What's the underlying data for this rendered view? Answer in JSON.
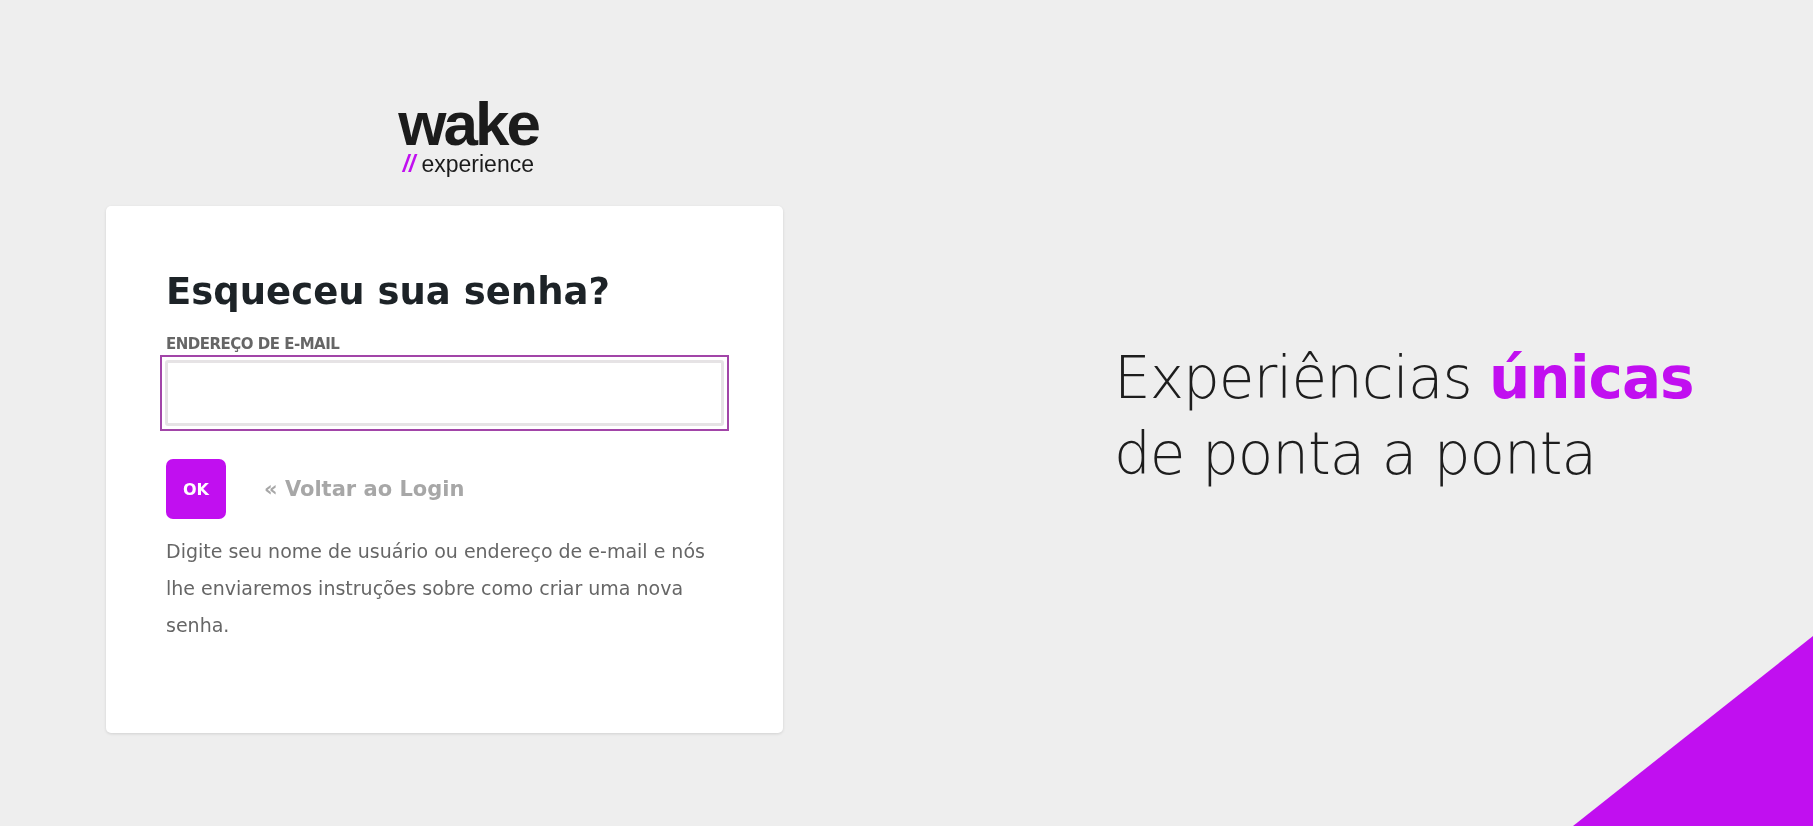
{
  "logo": {
    "wordmark": "wake",
    "mark": "//",
    "tagline": "experience"
  },
  "form": {
    "title": "Esqueceu sua senha?",
    "email_label": "ENDEREÇO DE E-MAIL",
    "email_field": {
      "focused": true
    },
    "submit": "OK",
    "back_link": "« Voltar ao Login",
    "help": "Digite seu nome de usuário ou endereço de e-mail e nós lhe enviaremos instruções sobre como criar uma nova senha."
  },
  "hero": {
    "line1": "Experiências **únicas**",
    "line2": "de ponta a ponta"
  }
}
